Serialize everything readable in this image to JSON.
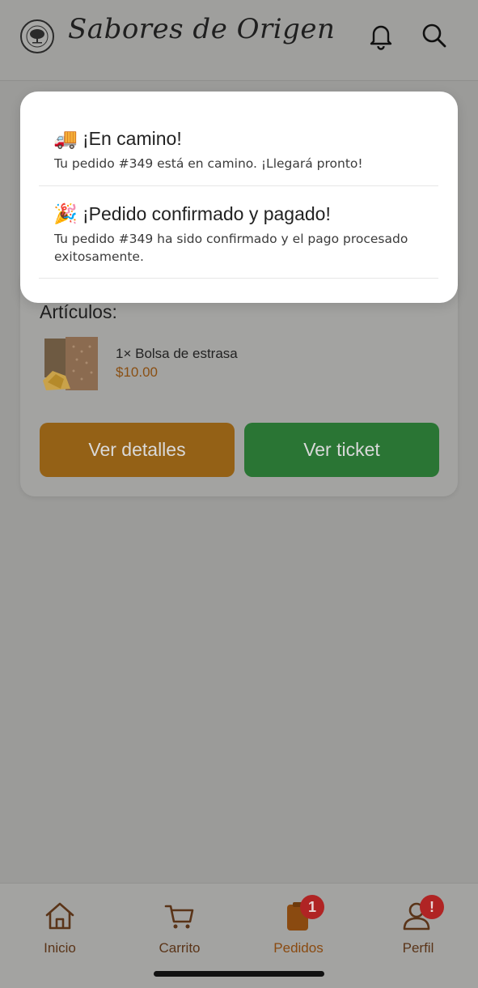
{
  "header": {
    "brand": "Sabores de Origen",
    "logo_icon": "tree-logo-icon",
    "notifications_icon": "bell-icon",
    "search_icon": "search-icon"
  },
  "notifications": [
    {
      "emoji": "🚚",
      "title": "¡En camino!",
      "body": "Tu pedido #349 está en camino. ¡Llegará pronto!"
    },
    {
      "emoji": "🎉",
      "title": "¡Pedido confirmado y pagado!",
      "body": "Tu pedido #349 ha sido confirmado y el pago procesado exitosamente."
    }
  ],
  "order": {
    "items_title": "Artículos:",
    "items": [
      {
        "name": "1× Bolsa de estrasa",
        "price": "$10.00"
      }
    ],
    "details_button": "Ver detalles",
    "ticket_button": "Ver ticket"
  },
  "nav": {
    "items": [
      {
        "label": "Inicio",
        "icon": "home-icon"
      },
      {
        "label": "Carrito",
        "icon": "cart-icon"
      },
      {
        "label": "Pedidos",
        "icon": "orders-icon",
        "badge": "1",
        "active": true
      },
      {
        "label": "Perfil",
        "icon": "profile-icon",
        "badge": "!"
      }
    ]
  },
  "colors": {
    "accent": "#946116",
    "success": "#2a7534",
    "badge": "#b02424"
  }
}
